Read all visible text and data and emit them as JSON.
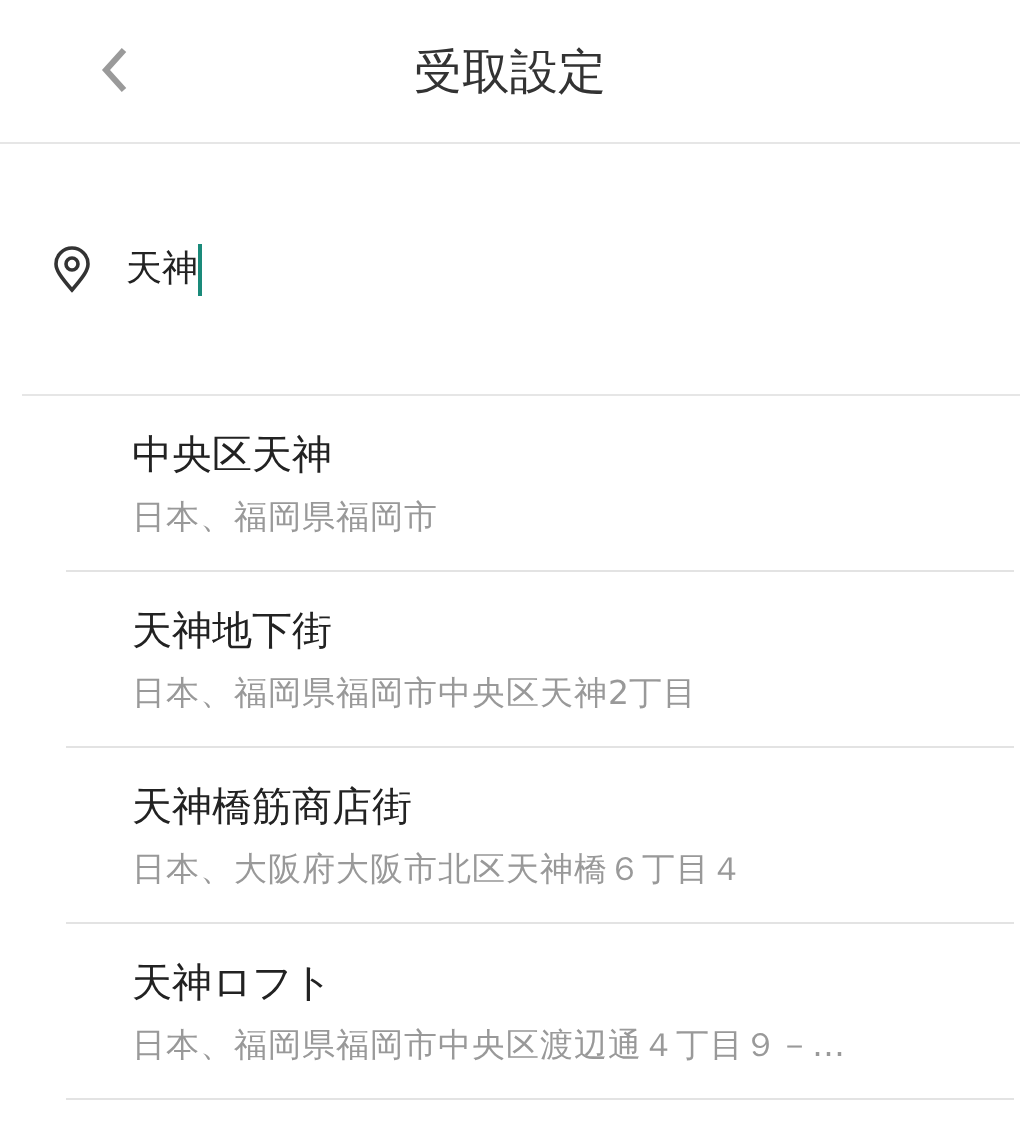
{
  "header": {
    "title": "受取設定"
  },
  "search": {
    "value": "天神"
  },
  "results": [
    {
      "name": "中央区天神",
      "address": "日本、福岡県福岡市"
    },
    {
      "name": "天神地下街",
      "address": "日本、福岡県福岡市中央区天神2丁目"
    },
    {
      "name": "天神橋筋商店街",
      "address": "日本、大阪府大阪市北区天神橋６丁目４"
    },
    {
      "name": "天神ロフト",
      "address": "日本、福岡県福岡市中央区渡辺通４丁目９－…"
    }
  ]
}
